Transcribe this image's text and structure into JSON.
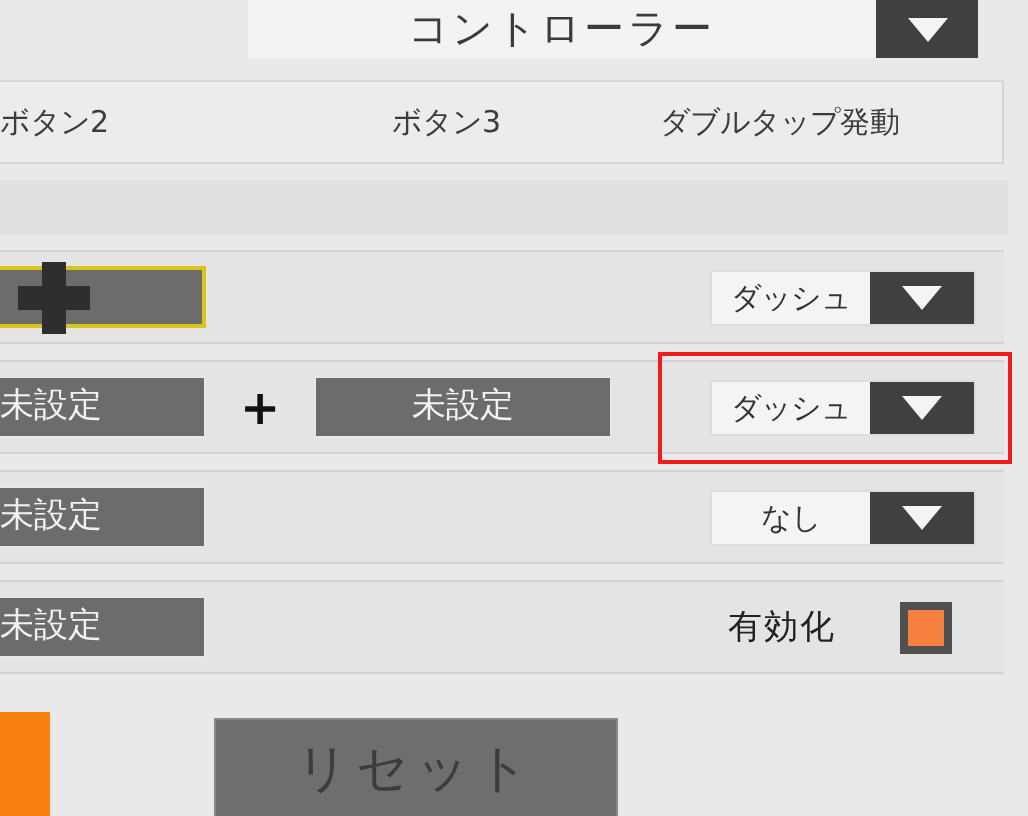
{
  "controller_select": {
    "value": "コントローラー"
  },
  "column_headers": [
    "ボタン2",
    "ボタン3",
    "ダブルタップ発動"
  ],
  "rows": [
    {
      "slots": [
        {
          "kind": "dpad",
          "focused": true
        }
      ],
      "option": {
        "kind": "dropdown",
        "value": "ダッシュ",
        "highlighted": false
      }
    },
    {
      "slots": [
        {
          "kind": "text",
          "value": "未設定",
          "focused": false
        },
        {
          "kind": "text",
          "value": "未設定",
          "focused": false
        }
      ],
      "joiner": "+",
      "option": {
        "kind": "dropdown",
        "value": "ダッシュ",
        "highlighted": true
      }
    },
    {
      "slots": [
        {
          "kind": "text",
          "value": "未設定",
          "focused": false
        }
      ],
      "option": {
        "kind": "dropdown",
        "value": "なし",
        "highlighted": false
      }
    },
    {
      "slots": [
        {
          "kind": "text",
          "value": "未設定",
          "focused": false
        }
      ],
      "option": {
        "kind": "checkbox",
        "label": "有効化",
        "checked": true
      }
    }
  ],
  "reset_button": "リセット"
}
